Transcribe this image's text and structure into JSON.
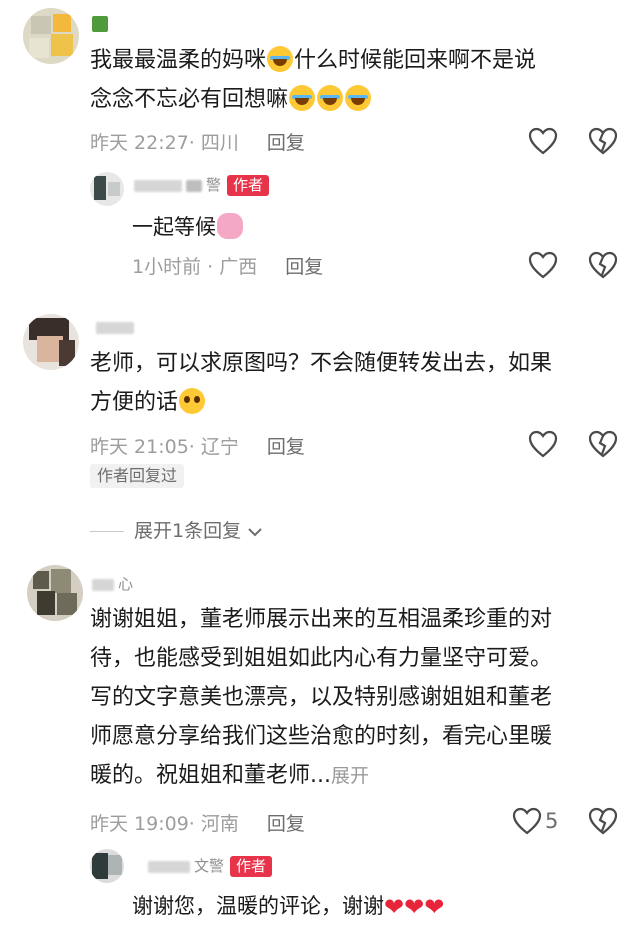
{
  "comments": [
    {
      "text_line1": "我最最温柔的妈咪",
      "text_mid": "什么时候能回来啊不是说",
      "text_line2": "念念不忘必有回想嘛",
      "meta": "昨天 22:27· 四川",
      "reply_label": "回复",
      "reply": {
        "name": "警",
        "badge": "作者",
        "text": "一起等候",
        "meta": "1小时前 · 广西",
        "reply_label": "回复"
      }
    },
    {
      "text_line1": "老师，可以求原图吗？不会随便转发出去，如果",
      "text_line2": "方便的话",
      "meta": "昨天 21:05· 辽宁",
      "reply_label": "回复",
      "tag": "作者回复过",
      "expand_replies": "展开1条回复"
    },
    {
      "name": "心",
      "text_lines": [
        "谢谢姐姐，董老师展示出来的互相温柔珍重的对",
        "待，也能感受到姐姐如此内心有力量坚守可爱。",
        "写的文字意美也漂亮，以及特别感谢姐姐和董老",
        "师愿意分享给我们这些治愈的时刻，看完心里暖"
      ],
      "text_last": "暖的。祝姐姐和董老师...",
      "expand": "展开",
      "meta": "昨天 19:09· 河南",
      "reply_label": "回复",
      "like_count": "5",
      "reply": {
        "name": "文警",
        "badge": "作者",
        "text": "谢谢您，温暖的评论，谢谢"
      }
    }
  ],
  "icons": {
    "like": "heart-outline-icon",
    "dislike": "broken-heart-icon",
    "chevron": "chevron-down-icon",
    "heart_emoji": "red-heart-emoji"
  }
}
